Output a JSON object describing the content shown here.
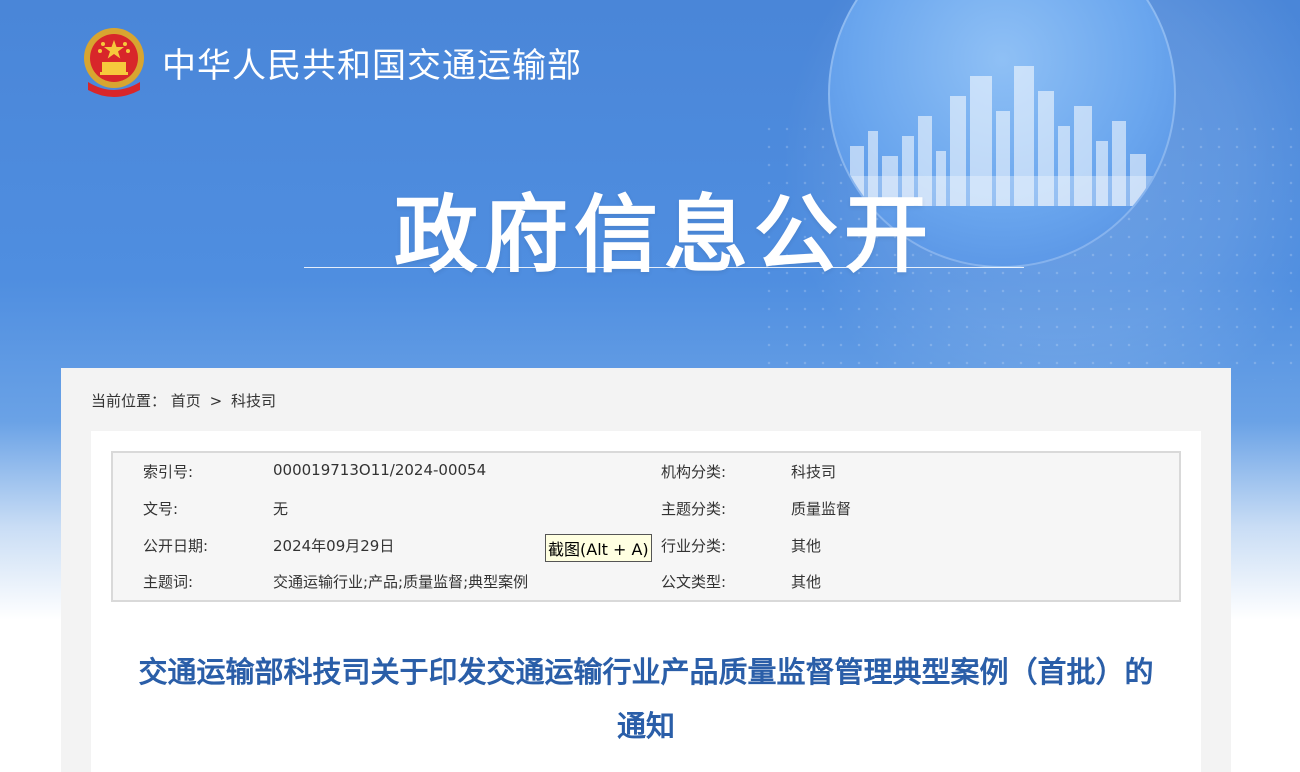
{
  "header": {
    "site_title": "中华人民共和国交通运输部",
    "section_title": "政府信息公开"
  },
  "breadcrumb": {
    "prefix": "当前位置：",
    "home": "首页",
    "separator": ">",
    "current": "科技司"
  },
  "meta": {
    "rows": [
      {
        "left_label": "索引号:",
        "left_value": "000019713O11/2024-00054",
        "right_label": "机构分类:",
        "right_value": "科技司"
      },
      {
        "left_label": "文号:",
        "left_value": "无",
        "right_label": "主题分类:",
        "right_value": "质量监督"
      },
      {
        "left_label": "公开日期:",
        "left_value": "2024年09月29日",
        "right_label": "行业分类:",
        "right_value": "其他"
      },
      {
        "left_label": "主题词:",
        "left_value": "交通运输行业;产品;质量监督;典型案例",
        "right_label": "公文类型:",
        "right_value": "其他"
      }
    ]
  },
  "tooltip": {
    "text": "截图(Alt + A)"
  },
  "document": {
    "title": "交通运输部科技司关于印发交通运输行业产品质量监督管理典型案例（首批）的通知"
  },
  "colors": {
    "banner_blue": "#4a86d8",
    "title_blue": "#2a5ea8",
    "panel_gray": "#f3f3f3"
  }
}
